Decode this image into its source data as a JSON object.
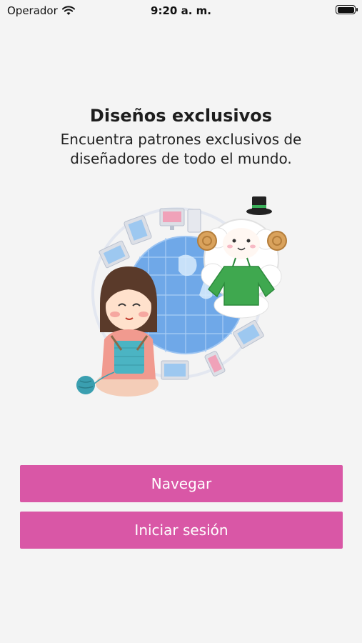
{
  "status_bar": {
    "carrier": "Operador",
    "time": "9:20 a. m.",
    "icons": [
      "wifi-icon",
      "battery-icon"
    ]
  },
  "onboarding": {
    "title": "Diseños exclusivos",
    "subtitle": "Encuentra patrones exclusivos de diseñadores de todo el mundo.",
    "illustration": "knitting-girl-and-sheep-around-globe"
  },
  "actions": {
    "browse_label": "Navegar",
    "login_label": "Iniciar sesión"
  },
  "colors": {
    "background": "#f4f4f4",
    "button": "#d957a6",
    "button_text": "#ffffff"
  }
}
